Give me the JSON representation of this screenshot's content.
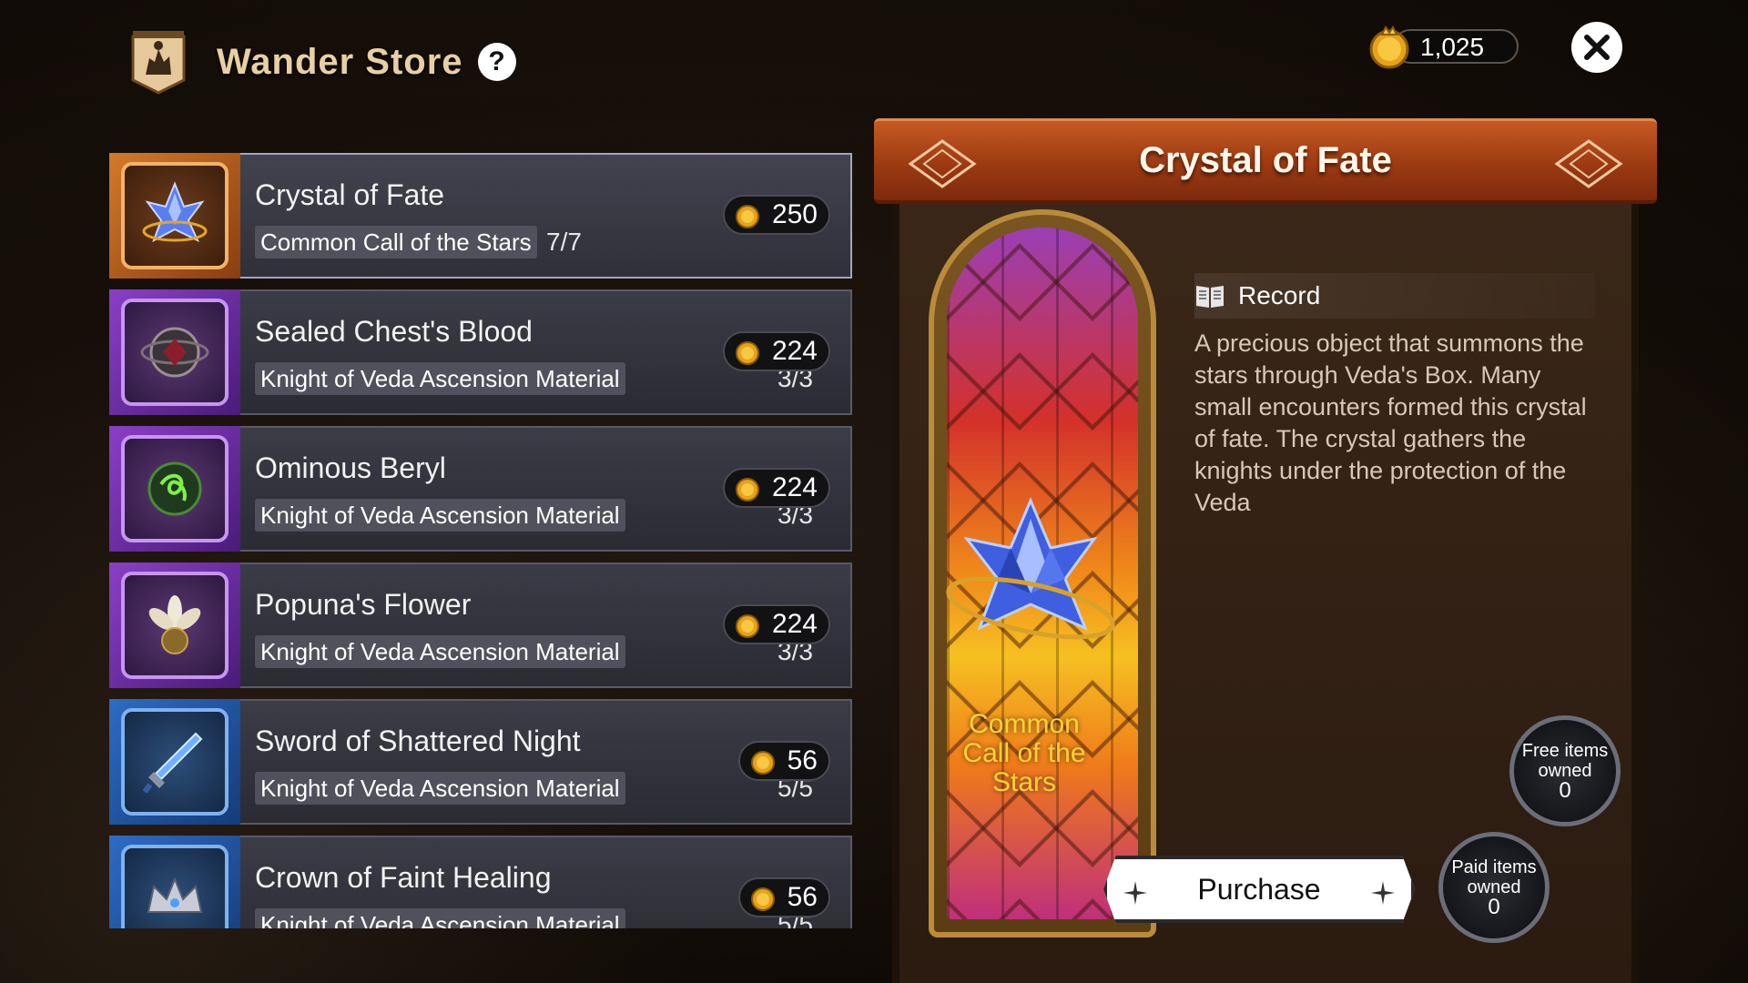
{
  "header": {
    "title": "Wander Store",
    "help_label": "?"
  },
  "currency": {
    "amount": "1,025"
  },
  "items": [
    {
      "name": "Crystal of Fate",
      "tag": "Common Call of the Stars",
      "stock": "7/7",
      "price": "250",
      "rarity": "orange",
      "icon": "crystal-icon"
    },
    {
      "name": "Sealed Chest's Blood",
      "tag": "Knight of Veda Ascension Material",
      "stock": "3/3",
      "price": "224",
      "rarity": "purple",
      "icon": "sealed-orb-icon"
    },
    {
      "name": "Ominous Beryl",
      "tag": "Knight of Veda Ascension Material",
      "stock": "3/3",
      "price": "224",
      "rarity": "purple",
      "icon": "beryl-icon"
    },
    {
      "name": "Popuna's Flower",
      "tag": "Knight of Veda Ascension Material",
      "stock": "3/3",
      "price": "224",
      "rarity": "purple",
      "icon": "flower-icon"
    },
    {
      "name": "Sword of Shattered Night",
      "tag": "Knight of Veda Ascension Material",
      "stock": "5/5",
      "price": "56",
      "rarity": "blue",
      "icon": "sword-icon"
    },
    {
      "name": "Crown of Faint Healing",
      "tag": "Knight of Veda Ascension Material",
      "stock": "5/5",
      "price": "56",
      "rarity": "blue",
      "icon": "crown-icon"
    }
  ],
  "detail": {
    "title": "Crystal of Fate",
    "caption": "Common Call of the Stars",
    "record_label": "Record",
    "description": "A precious object that summons the stars through Veda's Box. Many small encounters formed this crystal of fate. The crystal gathers the knights under the protection of the Veda",
    "purchase_label": "Purchase",
    "free_owned_label": "Free items owned",
    "free_owned_count": "0",
    "paid_owned_label": "Paid items owned",
    "paid_owned_count": "0"
  },
  "colors": {
    "title_gold": "#e8cfa4",
    "banner_orange": "#c65a22",
    "caption_yellow": "#ffd23a"
  }
}
